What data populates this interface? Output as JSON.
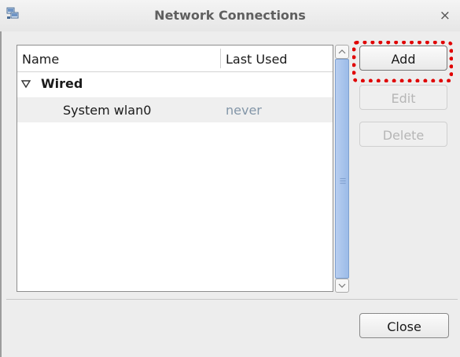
{
  "window": {
    "title": "Network Connections",
    "close_glyph": "×"
  },
  "list": {
    "columns": [
      "Name",
      "Last Used"
    ],
    "groups": [
      {
        "label": "Wired",
        "expanded": true,
        "connections": [
          {
            "name": "System wlan0",
            "last_used": "never"
          }
        ]
      }
    ]
  },
  "buttons": {
    "add": "Add",
    "edit": "Edit",
    "delete": "Delete",
    "close": "Close"
  },
  "state": {
    "edit_enabled": false,
    "delete_enabled": false
  },
  "colors": {
    "highlight": "#e00000",
    "scroll_thumb": "#9bbbe8",
    "muted_text": "#8396a8"
  },
  "icons": {
    "app": "network-connections-icon",
    "expander": "triangle-down-icon",
    "close": "close-icon"
  }
}
